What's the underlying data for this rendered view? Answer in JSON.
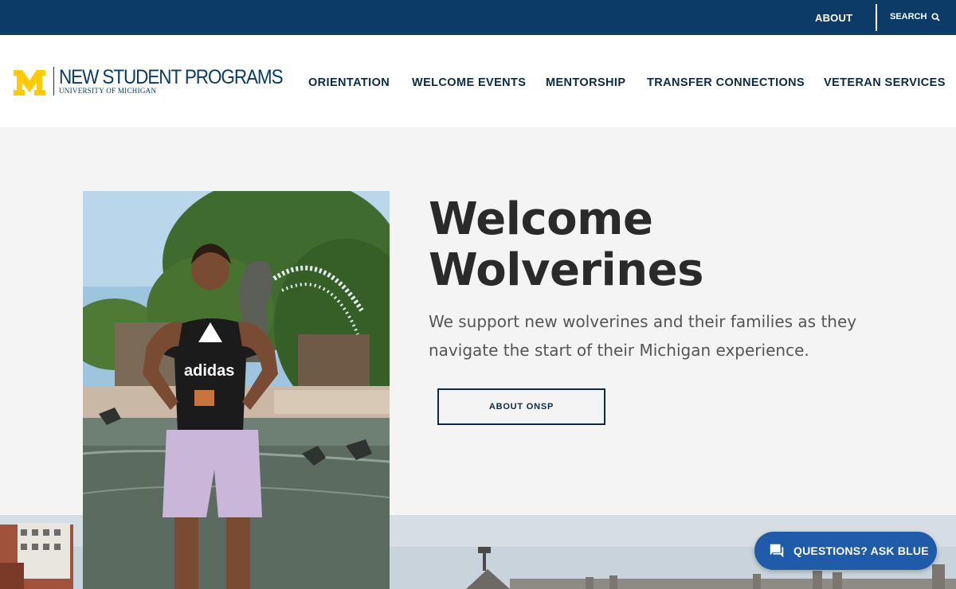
{
  "utility": {
    "about_label": "ABOUT",
    "search_label": "SEARCH",
    "search_icon": "magnifier-icon"
  },
  "brand": {
    "title": "NEW STUDENT PROGRAMS",
    "subtitle": "UNIVERSITY OF MICHIGAN",
    "mark_letter": "M",
    "maize": "#ffcb05",
    "blue": "#0b3b66"
  },
  "nav": {
    "items": [
      {
        "label": "ORIENTATION"
      },
      {
        "label": "WELCOME EVENTS"
      },
      {
        "label": "MENTORSHIP"
      },
      {
        "label": "TRANSFER CONNECTIONS"
      },
      {
        "label": "VETERAN SERVICES"
      }
    ]
  },
  "hero": {
    "title_line1": "Welcome",
    "title_line2": "Wolverines",
    "description": "We support new wolverines and their families as they navigate the start of their Michigan experience.",
    "button_label": "ABOUT ONSP",
    "photo_caption_shirt": "adidas"
  },
  "chat": {
    "label": "QUESTIONS? ASK BLUE",
    "icon": "chat-bubble-icon",
    "color": "#1f5ba8"
  }
}
